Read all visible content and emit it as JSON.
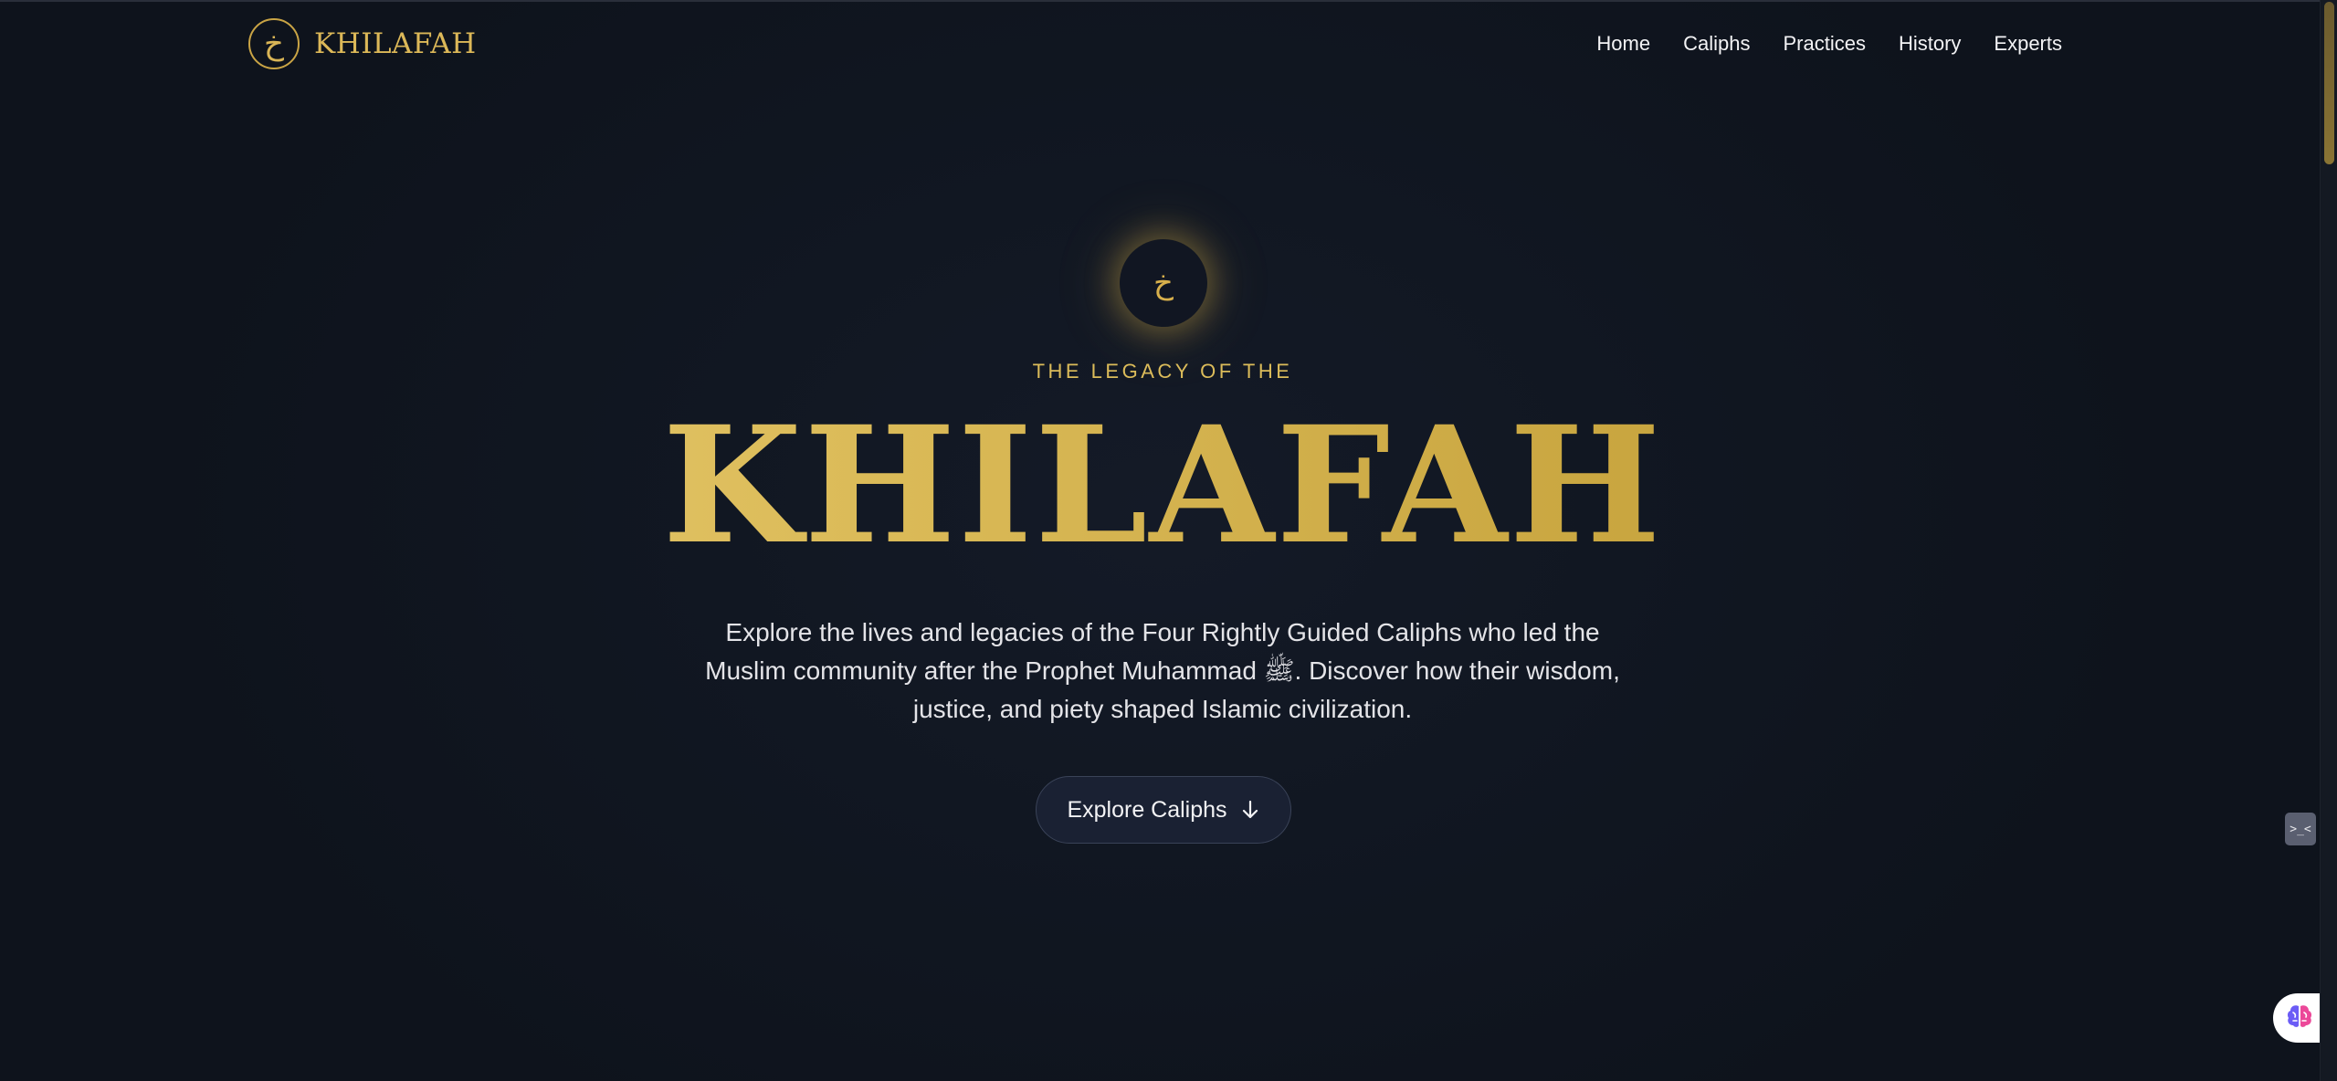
{
  "header": {
    "logo_glyph": "خ",
    "logo_text": "KHILAFAH",
    "nav": [
      "Home",
      "Caliphs",
      "Practices",
      "History",
      "Experts"
    ]
  },
  "hero": {
    "emblem_glyph": "خ",
    "eyebrow": "THE LEGACY OF THE",
    "title": "KHILAFAH",
    "description": "Explore the lives and legacies of the Four Rightly Guided Caliphs who led the Muslim community after the Prophet Muhammad ﷺ. Discover how their wisdom, justice, and piety shaped Islamic civilization.",
    "cta_label": "Explore Caliphs"
  },
  "widgets": {
    "side_widget_text": ">_<"
  },
  "icons": {
    "cta": "arrow-down-icon",
    "brain": "brain-icon"
  },
  "colors": {
    "background": "#0f141e",
    "gold": "#dcbc5a",
    "button_bg": "#1a2133"
  }
}
